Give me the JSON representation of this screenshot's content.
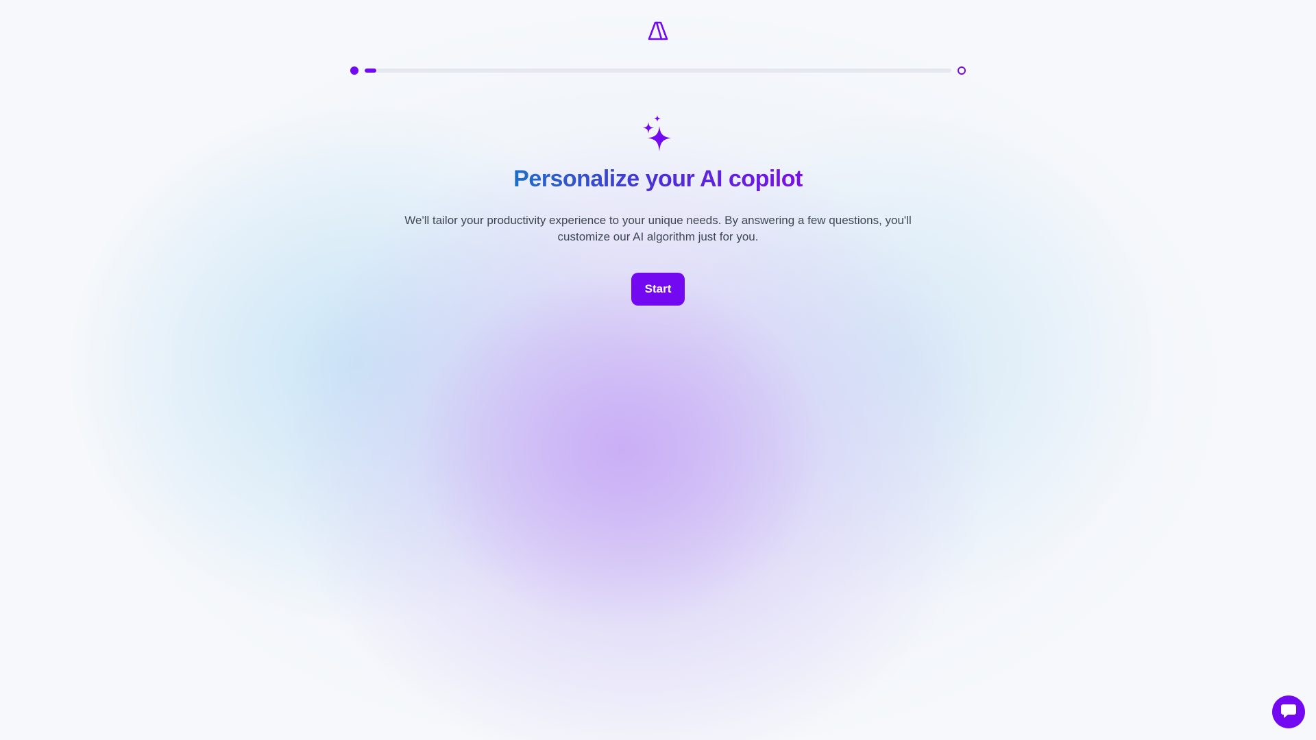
{
  "brand": {
    "logo_icon": "brand-logo-icon",
    "accent_color": "#7209f0"
  },
  "progress": {
    "value_fraction": 0.02,
    "start_icon": "progress-start-dot",
    "end_icon": "progress-end-ring"
  },
  "hero": {
    "icon": "sparkles-icon",
    "title": "Personalize your AI copilot",
    "subtitle": "We'll tailor your productivity experience to your unique needs. By answering a few questions, you'll customize our AI algorithm just for you.",
    "start_label": "Start"
  },
  "chat": {
    "icon": "chat-bubble-icon"
  }
}
